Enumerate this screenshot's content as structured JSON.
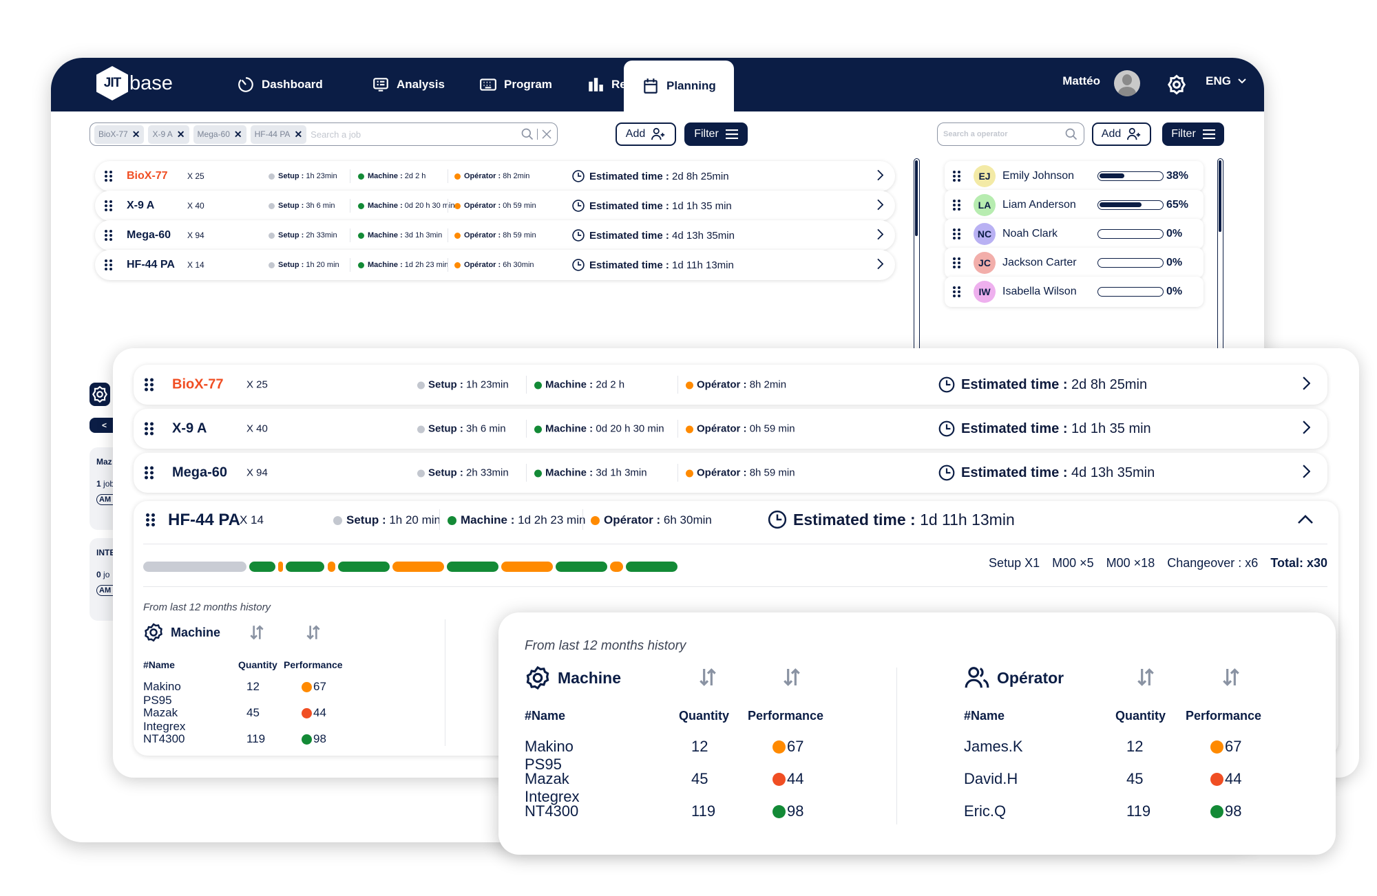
{
  "nav": {
    "logo_bold": "JIT",
    "logo_light": "base",
    "items": [
      {
        "label": "Dashboard",
        "icon": "timer-icon"
      },
      {
        "label": "Analysis",
        "icon": "monitor-list-icon"
      },
      {
        "label": "Program",
        "icon": "keyboard-icon"
      },
      {
        "label": "Report",
        "icon": "bar-chart-icon"
      },
      {
        "label": "Planning",
        "icon": "calendar-icon",
        "active": true
      }
    ],
    "user": "Mattéo",
    "language": "ENG"
  },
  "job_search": {
    "chips": [
      "BioX-77",
      "X-9 A",
      "Mega-60",
      "HF-44 PA"
    ],
    "placeholder": "Search a job"
  },
  "job_actions": {
    "add": "Add",
    "filter": "Filter"
  },
  "operator_search": {
    "placeholder": "Search a operator"
  },
  "operator_actions": {
    "add": "Add",
    "filter": "Filter"
  },
  "labels": {
    "setup": "Setup",
    "machine": "Machine",
    "operator": "Opérator",
    "estimated": "Estimated time",
    "sep": " : "
  },
  "jobs": [
    {
      "name": "BioX-77",
      "qty": "X 25",
      "setup": "1h 23min",
      "machine": "2d 2 h",
      "operator": "8h 2min",
      "estimated": "2d 8h 25min",
      "highlight": true
    },
    {
      "name": "X-9 A",
      "qty": "X 40",
      "setup": "3h 6 min",
      "machine": "0d 20 h 30 min",
      "operator": "0h 59 min",
      "estimated": "1d 1h 35 min"
    },
    {
      "name": "Mega-60",
      "qty": "X 94",
      "setup": "2h  33min",
      "machine": "3d 1h 3min",
      "operator": "8h 59 min",
      "estimated": "4d 13h 35min"
    },
    {
      "name": "HF-44 PA",
      "qty": "X 14",
      "setup": "1h 20 min",
      "machine": "1d 2h 23 min",
      "operator": "6h 30min",
      "estimated": "1d 11h 13min"
    }
  ],
  "operators": [
    {
      "initials": "EJ",
      "name": "Emily Johnson",
      "load_pct": 38,
      "load_label": "38%",
      "color": "#f3eaa6"
    },
    {
      "initials": "LA",
      "name": "Liam Anderson",
      "load_pct": 65,
      "load_label": "65%",
      "color": "#b7ecb0"
    },
    {
      "initials": "NC",
      "name": "Noah Clark",
      "load_pct": 0,
      "load_label": "0%",
      "color": "#b9b1f3"
    },
    {
      "initials": "JC",
      "name": "Jackson Carter",
      "load_pct": 0,
      "load_label": "0%",
      "color": "#f2aeaa"
    },
    {
      "initials": "IW",
      "name": "Isabella Wilson",
      "load_pct": 0,
      "load_label": "0%",
      "color": "#eeb0ee"
    }
  ],
  "side_panel": {
    "cards": [
      {
        "title": "Maz",
        "jobs_count": "1",
        "jobs_label": " job",
        "pill": "AM"
      },
      {
        "title": "INTE",
        "jobs_count": "0",
        "jobs_label": " jo",
        "pill": "AM"
      }
    ],
    "back_label": "<"
  },
  "expanded_job": {
    "sequence": [
      {
        "type": "setup",
        "weight": 8
      },
      {
        "type": "machine",
        "weight": 2
      },
      {
        "type": "operator",
        "weight": 0.4
      },
      {
        "type": "machine",
        "weight": 3
      },
      {
        "type": "operator",
        "weight": 0.6
      },
      {
        "type": "machine",
        "weight": 4
      },
      {
        "type": "operator",
        "weight": 4
      },
      {
        "type": "machine",
        "weight": 4
      },
      {
        "type": "operator",
        "weight": 4
      },
      {
        "type": "machine",
        "weight": 4
      },
      {
        "type": "operator",
        "weight": 1
      },
      {
        "type": "machine",
        "weight": 4
      }
    ],
    "summary": [
      "Setup X1",
      "M00 ×5",
      "M00 ×18",
      "Changeover : x6"
    ],
    "total": "Total: x30"
  },
  "colors": {
    "navy": "#0b1d45",
    "setup": "#c9ccd4",
    "machine": "#138a36",
    "operator": "#ff8a00",
    "alert": "#f04e23"
  },
  "history": {
    "title": "From last 12 months history",
    "machine": {
      "heading": "Machine",
      "columns": [
        "#Name",
        "Quantity",
        "Performance"
      ],
      "rows": [
        {
          "name": "Makino PS95",
          "qty": "12",
          "perf": "67",
          "status": "operator"
        },
        {
          "name": "Mazak Integrex",
          "qty": "45",
          "perf": "44",
          "status": "alert"
        },
        {
          "name": "NT4300",
          "qty": "119",
          "perf": "98",
          "status": "machine"
        }
      ]
    },
    "operator": {
      "heading": "Opérator",
      "columns": [
        "#Name",
        "Quantity",
        "Performance"
      ],
      "rows": [
        {
          "name": "James.K",
          "qty": "12",
          "perf": "67",
          "status": "operator"
        },
        {
          "name": "David.H",
          "qty": "45",
          "perf": "44",
          "status": "alert"
        },
        {
          "name": "Eric.Q",
          "qty": "119",
          "perf": "98",
          "status": "machine"
        }
      ]
    }
  }
}
